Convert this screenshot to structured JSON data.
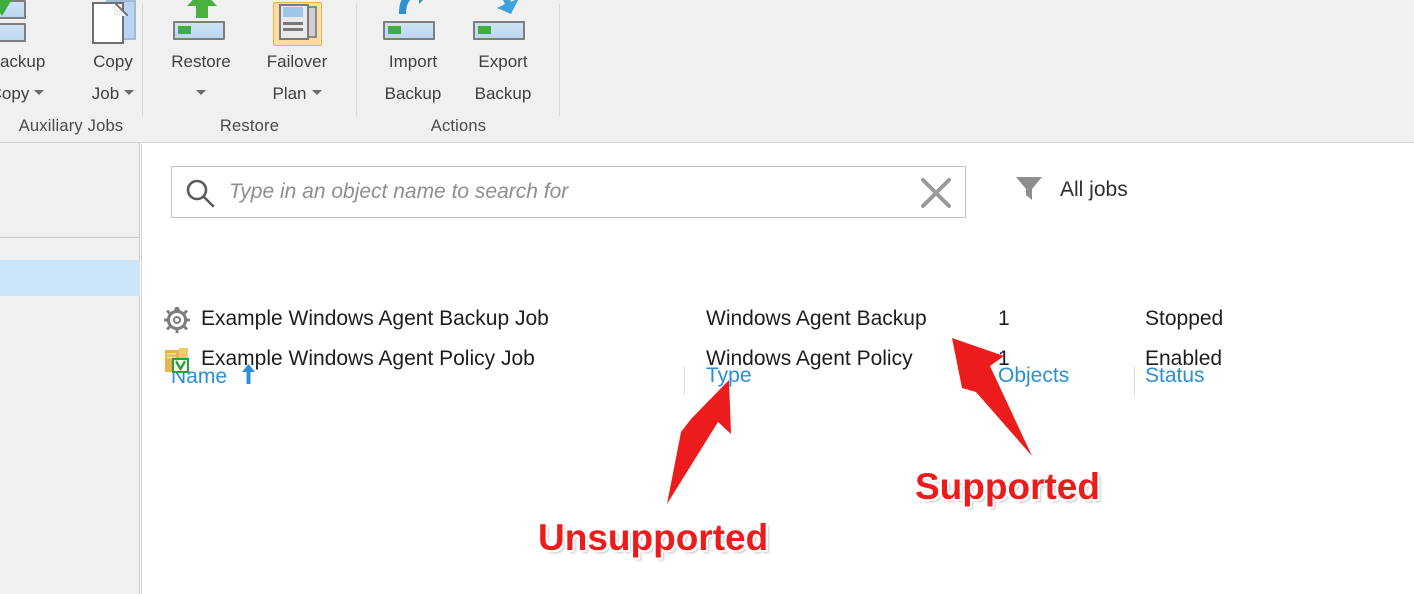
{
  "ribbon": {
    "groups": [
      {
        "label": "Auxiliary Jobs"
      },
      {
        "label": "Restore"
      },
      {
        "label": "Actions"
      }
    ],
    "buttons": [
      {
        "name": "backup-copy",
        "line1": "Backup",
        "line2": "Copy",
        "icon": "backup-copy-icon",
        "has_caret": true
      },
      {
        "name": "copy-job",
        "line1": "Copy",
        "line2": "Job",
        "icon": "copy-job-icon",
        "has_caret": true
      },
      {
        "name": "restore",
        "line1": "Restore",
        "line2": "",
        "icon": "restore-icon",
        "has_caret": true
      },
      {
        "name": "failover-plan",
        "line1": "Failover",
        "line2": "Plan",
        "icon": "failover-plan-icon",
        "has_caret": true
      },
      {
        "name": "import-backup",
        "line1": "Import",
        "line2": "Backup",
        "icon": "import-backup-icon",
        "has_caret": false
      },
      {
        "name": "export-backup",
        "line1": "Export",
        "line2": "Backup",
        "icon": "export-backup-icon",
        "has_caret": false
      }
    ]
  },
  "search": {
    "placeholder": "Type in an object name to search for",
    "value": "",
    "search_icon": "magnifier-icon",
    "clear_icon": "clear-x-icon"
  },
  "filter": {
    "label": "All jobs",
    "icon": "funnel-filter-icon"
  },
  "grid": {
    "columns": [
      {
        "key": "name",
        "label": "Name",
        "sorted": true,
        "sort_direction": "ascending"
      },
      {
        "key": "type",
        "label": "Type"
      },
      {
        "key": "objects",
        "label": "Objects"
      },
      {
        "key": "status",
        "label": "Status"
      }
    ],
    "rows": [
      {
        "icon": "gear-job-icon",
        "name": "Example Windows Agent Backup Job",
        "type": "Windows Agent Backup",
        "objects": "1",
        "status": "Stopped"
      },
      {
        "icon": "policy-document-icon",
        "name": "Example Windows Agent Policy Job",
        "type": "Windows Agent Policy",
        "objects": "1",
        "status": "Enabled"
      }
    ]
  },
  "annotations": [
    {
      "name": "annotation-unsupported",
      "text": "Unsupported"
    },
    {
      "name": "annotation-supported",
      "text": "Supported"
    }
  ],
  "colors": {
    "accent_blue": "#2a8fd4",
    "annotation_red": "#ed1c1c",
    "ribbon_bg": "#f0f0f0",
    "selection_blue": "#cce4f7",
    "highlight_orange": "#fcdfa0"
  }
}
